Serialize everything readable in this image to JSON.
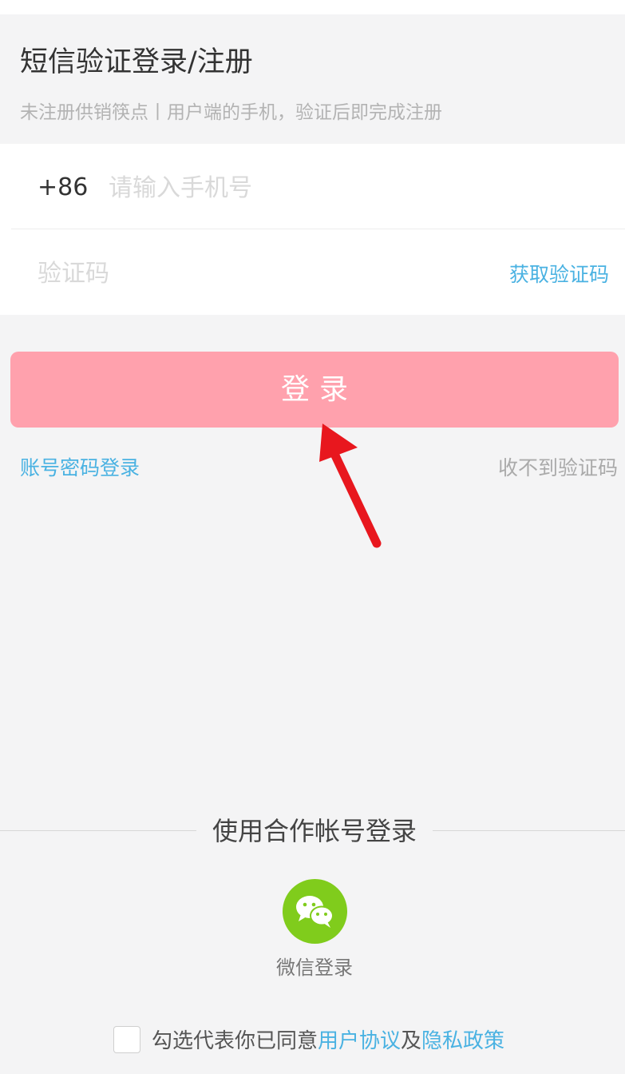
{
  "header": {
    "title": "短信验证登录/注册",
    "subtitle": "未注册供销筷点丨用户端的手机，验证后即完成注册"
  },
  "form": {
    "country_code": "+86",
    "phone_placeholder": "请输入手机号",
    "code_placeholder": "验证码",
    "get_code_label": "获取验证码"
  },
  "actions": {
    "login_label": "登录",
    "account_login_label": "账号密码登录",
    "no_code_label": "收不到验证码"
  },
  "partner": {
    "title": "使用合作帐号登录",
    "wechat_label": "微信登录",
    "wechat_icon": "wechat-icon"
  },
  "agreement": {
    "prefix": "勾选代表你已同意",
    "user_agreement": "用户协议",
    "conjunction": "及",
    "privacy_policy": "隐私政策",
    "checked": false
  },
  "annotation": {
    "arrow_icon": "red-arrow-icon"
  },
  "colors": {
    "background": "#f4f4f5",
    "accent_blue": "#4ab2e2",
    "login_button": "#ffa1ad",
    "wechat_green": "#80cc1c",
    "arrow_red": "#e8171e"
  }
}
